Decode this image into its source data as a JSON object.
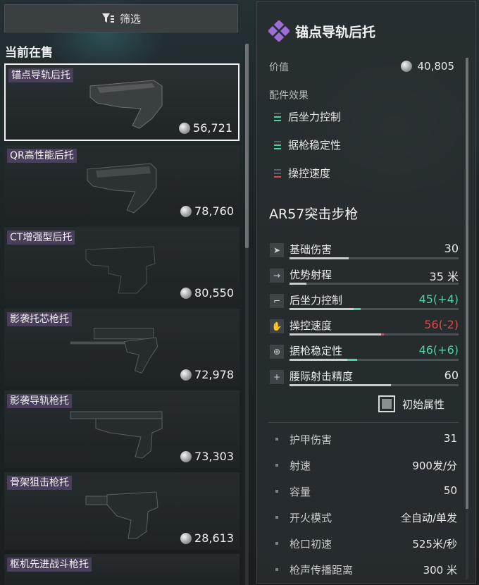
{
  "filter": {
    "label": "筛选",
    "icon": "funnel-icon"
  },
  "section_title": "当前在售",
  "items": [
    {
      "name": "锚点导轨后托",
      "price": "56,721",
      "selected": true
    },
    {
      "name": "QR高性能后托",
      "price": "78,760",
      "selected": false
    },
    {
      "name": "CT增强型后托",
      "price": "80,550",
      "selected": false
    },
    {
      "name": "影袭托芯枪托",
      "price": "72,978",
      "selected": false
    },
    {
      "name": "影袭导轨枪托",
      "price": "73,303",
      "selected": false
    },
    {
      "name": "骨架狙击枪托",
      "price": "28,613",
      "selected": false
    },
    {
      "name": "枢机先进战斗枪托",
      "price": "",
      "selected": false
    }
  ],
  "detail": {
    "title": "锚点导轨后托",
    "value_label": "价值",
    "value": "40,805",
    "effects_label": "配件效果",
    "effects": [
      {
        "name": "后坐力控制",
        "bars_on": 2,
        "color": "#4fd1a4"
      },
      {
        "name": "据枪稳定性",
        "bars_on": 2,
        "color": "#4fd1a4"
      },
      {
        "name": "操控速度",
        "bars_on": 1,
        "color": "#e0494a"
      }
    ],
    "weapon": "AR57突击步枪",
    "stats": [
      {
        "name": "基础伤害",
        "value": "30",
        "icon": "damage-icon",
        "fill": 0.35,
        "delta": 0,
        "status": "neutral"
      },
      {
        "name": "优势射程",
        "value": "35 米",
        "icon": "range-icon",
        "fill": 0.1,
        "delta": 0,
        "status": "neutral"
      },
      {
        "name": "后坐力控制",
        "value": "45(+4)",
        "icon": "recoil-icon",
        "fill": 0.42,
        "delta": 0.04,
        "status": "pos"
      },
      {
        "name": "操控速度",
        "value": "56(-2)",
        "icon": "handling-icon",
        "fill": 0.54,
        "delta": -0.02,
        "status": "neg"
      },
      {
        "name": "据枪稳定性",
        "value": "46(+6)",
        "icon": "crosshair-icon",
        "fill": 0.4,
        "delta": 0.06,
        "status": "pos"
      },
      {
        "name": "腰际射击精度",
        "value": "60",
        "icon": "hipfire-icon",
        "fill": 0.6,
        "delta": 0,
        "status": "neutral"
      }
    ],
    "base_toggle_label": "初始属性",
    "attributes": [
      {
        "name": "护甲伤害",
        "value": "31"
      },
      {
        "name": "射速",
        "value": "900发/分"
      },
      {
        "name": "容量",
        "value": "50"
      },
      {
        "name": "开火模式",
        "value": "全自动/单发"
      },
      {
        "name": "枪口初速",
        "value": "525米/秒"
      },
      {
        "name": "枪声传播距离",
        "value": "300 米"
      }
    ]
  },
  "colors": {
    "accent_purple": "#9b6fd6",
    "positive": "#4fd1a4",
    "negative": "#e0494a"
  }
}
